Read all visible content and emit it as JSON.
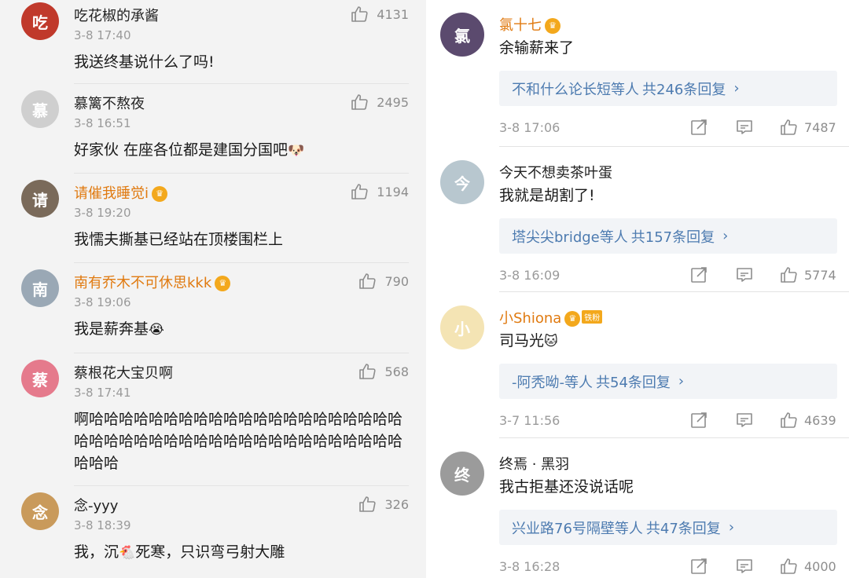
{
  "left_comments": [
    {
      "name": "吃花椒的承酱",
      "name_gold": false,
      "vip": false,
      "time": "3-8 17:40",
      "text": "我送终基说什么了吗!",
      "emoji": "",
      "likes": "4131",
      "avatar_color": "#c0392b"
    },
    {
      "name": "慕篱不熬夜",
      "name_gold": false,
      "vip": false,
      "time": "3-8 16:51",
      "text": "好家伙 在座各位都是建国分国吧",
      "emoji": "🐶",
      "likes": "2495",
      "avatar_color": "#cfcfcf"
    },
    {
      "name": "请催我睡觉i",
      "name_gold": true,
      "vip": true,
      "time": "3-8 19:20",
      "text": "我懦夫撕基已经站在顶楼围栏上",
      "emoji": "",
      "likes": "1194",
      "avatar_color": "#7a6a5a"
    },
    {
      "name": "南有乔木不可休思kkk",
      "name_gold": true,
      "vip": true,
      "time": "3-8 19:06",
      "text": "我是薪奔基",
      "emoji": "😭",
      "likes": "790",
      "avatar_color": "#9aa8b5"
    },
    {
      "name": "蔡根花大宝贝啊",
      "name_gold": false,
      "vip": false,
      "time": "3-8 17:41",
      "text": "啊哈哈哈哈哈哈哈哈哈哈哈哈哈哈哈哈哈哈哈哈哈哈哈哈哈哈哈哈哈哈哈哈哈哈哈哈哈哈哈哈哈哈哈哈哈哈",
      "emoji": "",
      "likes": "568",
      "avatar_color": "#e57a8c"
    },
    {
      "name": "念-yyy",
      "name_gold": false,
      "vip": false,
      "time": "3-8 18:39",
      "text": "我，沉",
      "emoji": "🐔",
      "text2": "死寒，只识弯弓射大雕",
      "likes": "326",
      "avatar_color": "#c99a5b"
    }
  ],
  "right_comments": [
    {
      "name": "氯十七",
      "name_gold": true,
      "vip": true,
      "fan": "",
      "text": "余输薪来了",
      "emoji": "",
      "reply_users": "不和什么论长短等人",
      "reply_count": "共246条回复",
      "time": "3-8 17:06",
      "likes": "7487",
      "avatar_color": "#5b4a6e"
    },
    {
      "name": "今天不想卖茶叶蛋",
      "name_gold": false,
      "vip": false,
      "fan": "",
      "text": "我就是胡割了!",
      "emoji": "",
      "reply_users": "塔尖尖bridge等人",
      "reply_count": "共157条回复",
      "time": "3-8 16:09",
      "likes": "5774",
      "avatar_color": "#b8c7cf"
    },
    {
      "name": "小Shiona",
      "name_gold": true,
      "vip": true,
      "fan": "铁粉",
      "text": "司马光",
      "emoji": "🐱",
      "reply_users": "-阿秃呦-等人",
      "reply_count": "共54条回复",
      "time": "3-7 11:56",
      "likes": "4639",
      "avatar_color": "#f4e4b4"
    },
    {
      "name": "终焉 · 黑羽",
      "name_gold": false,
      "vip": false,
      "fan": "",
      "text": "我古拒基还没说话呢",
      "emoji": "",
      "reply_users": "兴业路76号隔壁等人",
      "reply_count": "共47条回复",
      "time": "3-8 16:28",
      "likes": "4000",
      "avatar_color": "#9b9b9b"
    }
  ],
  "icons": {
    "like": "thumbs-up-icon",
    "share": "share-icon",
    "comment": "comment-icon",
    "chevron": "chevron-right-icon",
    "vip": "vip-badge-icon"
  }
}
